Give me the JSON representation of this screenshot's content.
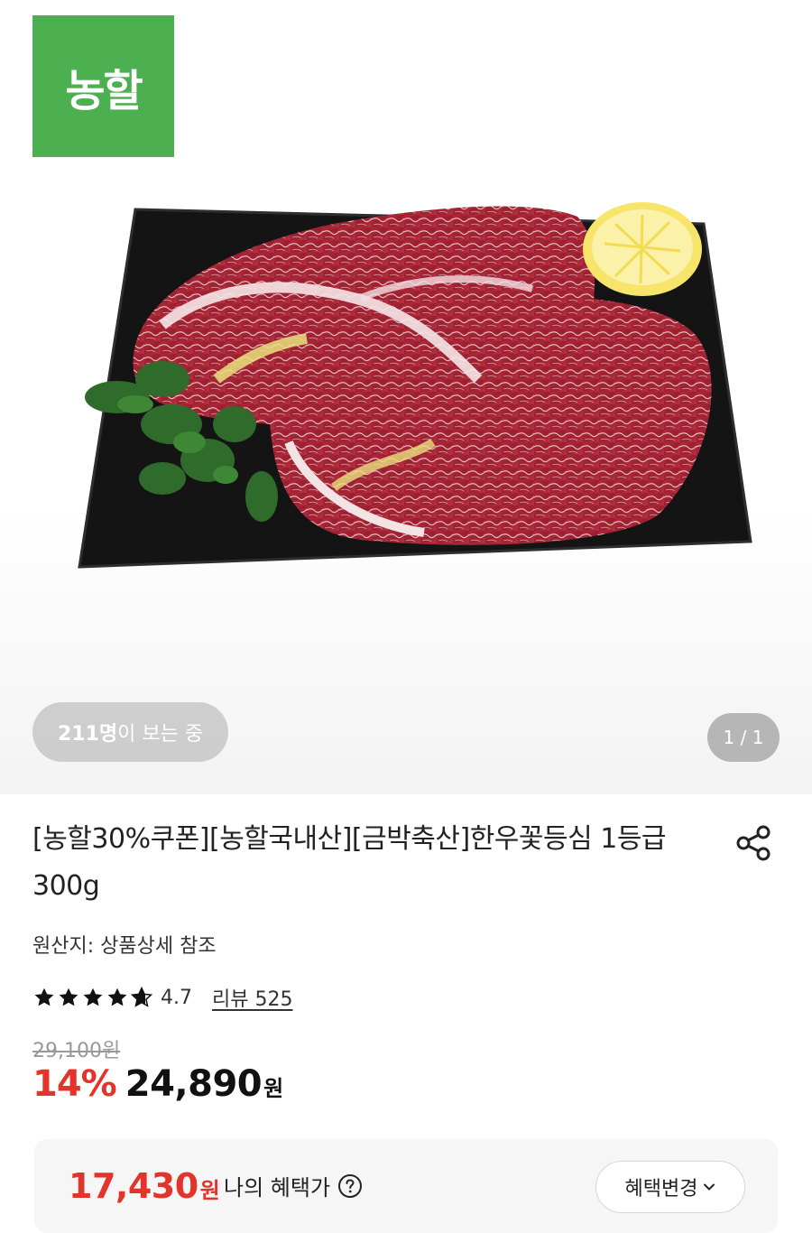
{
  "brand": {
    "logo_text": "농할",
    "logo_color": "#4caf50"
  },
  "gallery": {
    "viewers_count": "211명",
    "viewers_suffix": "이 보는 중",
    "page_indicator": "1 / 1",
    "image_subject": "marbled beef ribeye steaks with lemon and parsley on black plate"
  },
  "product": {
    "title": "[농할30%쿠폰][농할국내산][금박축산]한우꽃등심 1등급 300g",
    "origin": "원산지: 상품상세 참조",
    "rating": "4.7",
    "rating_stars": 4.7,
    "review_link": "리뷰 525",
    "original_price": "29,100원",
    "discount": "14%",
    "price": "24,890",
    "price_unit": "원"
  },
  "benefit": {
    "price": "17,430",
    "price_unit": "원",
    "label": "나의 혜택가",
    "change_button": "혜택변경"
  },
  "colors": {
    "accent_red": "#e2342a",
    "brand_green": "#4caf50"
  },
  "icons": {
    "share": "share-icon",
    "help": "help-icon",
    "chevron": "chevron-down-icon",
    "star": "star-icon"
  }
}
